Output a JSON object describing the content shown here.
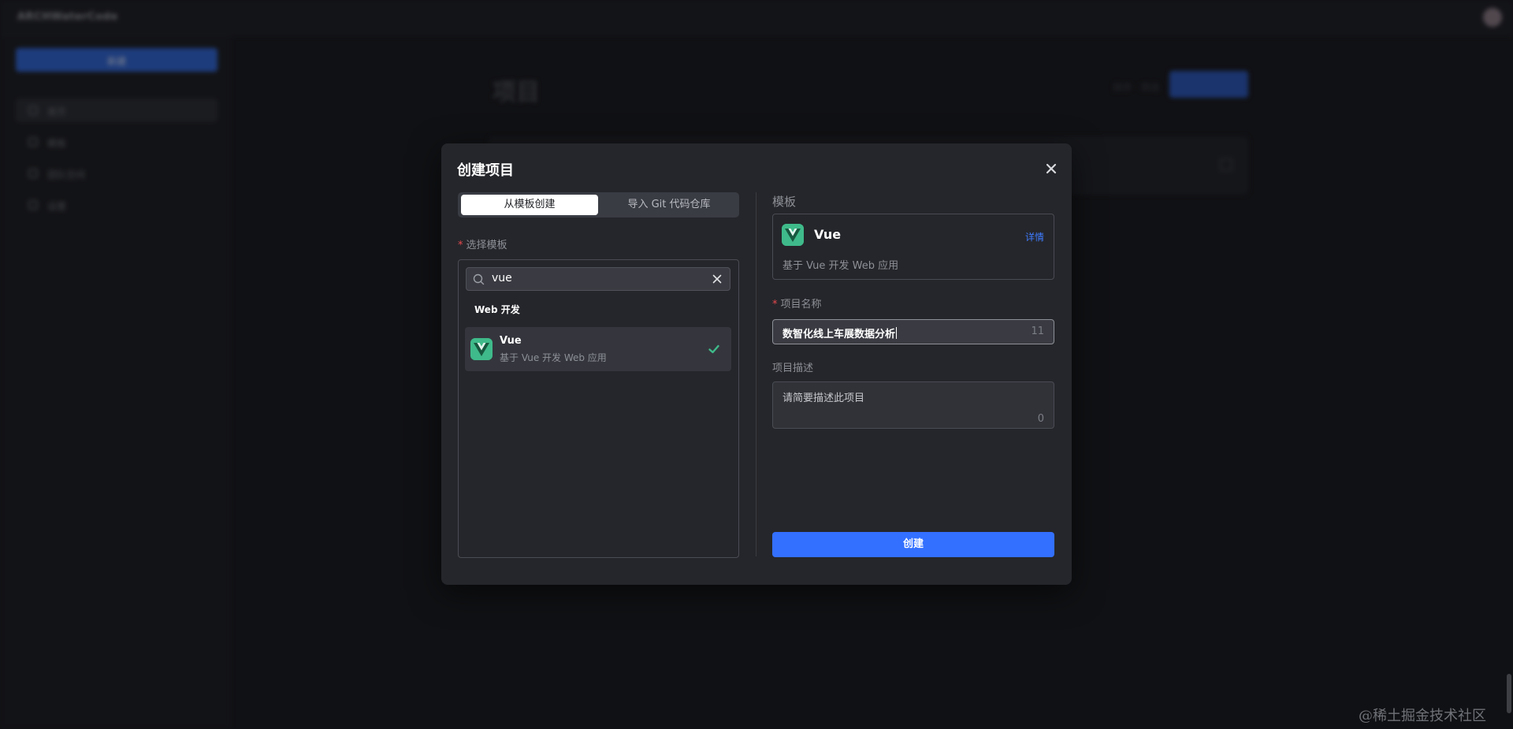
{
  "background": {
    "brand": "ARCHWaterCode",
    "new_button": "新建",
    "sidebar_items": [
      "首页",
      "模板",
      "团队空间",
      "设置"
    ],
    "page_title": "项目",
    "top_link": "排序 · 筛选",
    "top_button": "新建"
  },
  "modal": {
    "title": "创建项目",
    "tabs": [
      "从模板创建",
      "导入 Git 代码仓库"
    ],
    "select_label": "选择模板",
    "search_value": "vue",
    "group_title": "Web 开发",
    "template_item": {
      "name": "Vue",
      "description": "基于 Vue 开发 Web 应用"
    },
    "template_section_label": "模板",
    "selected_template": {
      "name": "Vue",
      "detail_link": "详情",
      "description": "基于 Vue 开发 Web 应用"
    },
    "name_label": "项目名称",
    "name_value": "数智化线上车展数据分析",
    "name_count": "11",
    "desc_label": "项目描述",
    "desc_placeholder": "请简要描述此项目",
    "desc_count": "0",
    "create_button": "创建"
  },
  "watermark": "@稀土掘金技术社区",
  "colors": {
    "accent": "#3370ff",
    "vue_green": "#3fba8a",
    "required": "#e5484d"
  },
  "icons": [
    "close-icon",
    "search-icon",
    "clear-icon",
    "vue-logo-icon",
    "check-icon"
  ]
}
